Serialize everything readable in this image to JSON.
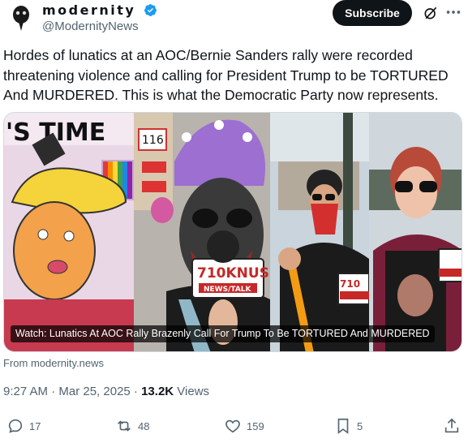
{
  "author": {
    "name": "modernity",
    "handle": "@ModernityNews",
    "avatar_icon": "crow-avatar-icon",
    "verified_icon": "verified-badge-icon"
  },
  "header": {
    "subscribe_label": "Subscribe",
    "grok_icon": "grok-icon",
    "more_icon": "more-icon"
  },
  "tweet": {
    "text": "Hordes of lunatics at an AOC/Bernie Sanders rally were recorded threatening violence and calling for President Trump to be TORTURED And MURDERED. This is what the Democratic Party now represents."
  },
  "media": {
    "sign_text": "'S TIME",
    "sign_number": "116",
    "mic_brand": "710KNUS",
    "mic_sub": "NEWS/TALK",
    "caption": "Watch: Lunatics At AOC Rally Brazenly Call For Trump To Be TORTURED And MURDERED"
  },
  "source": {
    "from": "From modernity.news"
  },
  "meta": {
    "time": "9:27 AM · Mar 25, 2025 · ",
    "views_count": "13.2K",
    "views_label": " Views"
  },
  "actions": {
    "replies": "17",
    "reposts": "48",
    "likes": "159",
    "bookmarks": "5"
  },
  "colors": {
    "text": "#0f1419",
    "muted": "#536471",
    "verified": "#1d9bf0"
  }
}
